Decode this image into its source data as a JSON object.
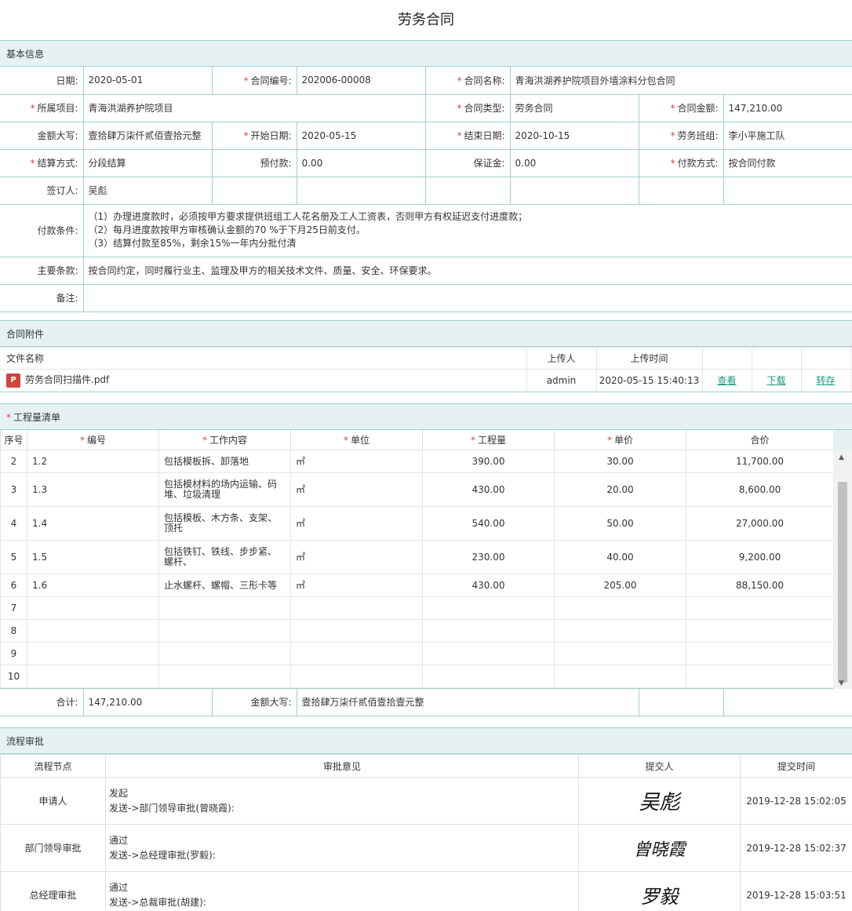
{
  "page_title": "劳务合同",
  "basic": {
    "section_title": "基本信息",
    "date_label": "日期:",
    "date": "2020-05-01",
    "contract_no_label": "合同编号:",
    "contract_no": "202006-00008",
    "contract_name_label": "合同名称:",
    "contract_name": "青海洪湖养护院项目外墙涂料分包合同",
    "project_label": "所属项目:",
    "project": "青海洪湖养护院项目",
    "contract_type_label": "合同类型:",
    "contract_type": "劳务合同",
    "amount_label": "合同金额:",
    "amount": "147,210.00",
    "amount_cn_label": "金额大写:",
    "amount_cn": "壹拾肆万柒仟贰佰壹拾元整",
    "start_label": "开始日期:",
    "start": "2020-05-15",
    "end_label": "结束日期:",
    "end": "2020-10-15",
    "team_label": "劳务班组:",
    "team": "李小平施工队",
    "settle_label": "结算方式:",
    "settle": "分段结算",
    "prepay_label": "预付款:",
    "prepay": "0.00",
    "deposit_label": "保证金:",
    "deposit": "0.00",
    "paymethod_label": "付款方式:",
    "paymethod": "按合同付款",
    "signer_label": "签订人:",
    "signer": "吴彪",
    "payterms_label": "付款条件:",
    "payterms": [
      "（1）办理进度款时，必须按甲方要求提供班组工人花名册及工人工资表，否则甲方有权延迟支付进度款；",
      "（2）每月进度款按甲方审核确认金额的70 %于下月25日前支付。",
      "（3）结算付款至85%，剩余15%一年内分批付清"
    ],
    "terms_label": "主要条款:",
    "terms": "按合同约定，同时履行业主、监理及甲方的相关技术文件、质量、安全、环保要求。",
    "remark_label": "备注:"
  },
  "attachments": {
    "section_title": "合同附件",
    "headers": [
      "文件名称",
      "上传人",
      "上传时间"
    ],
    "files": [
      {
        "name": "劳务合同扫描件.pdf",
        "uploader": "admin",
        "time": "2020-05-15 15:40:13",
        "view": "查看",
        "download": "下载",
        "transfer": "转存"
      }
    ]
  },
  "quantities": {
    "section_title": "工程量清单",
    "headers": [
      "序号",
      "编号",
      "工作内容",
      "单位",
      "工程量",
      "单价",
      "合价"
    ],
    "rows": [
      {
        "seq": "2",
        "code": "1.2",
        "content": "包括模板拆、卸落地",
        "unit": "㎡",
        "qty": "390.00",
        "price": "30.00",
        "total": "11,700.00"
      },
      {
        "seq": "3",
        "code": "1.3",
        "content": "包括模材料的场内运输、码堆、垃圾清理",
        "unit": "㎡",
        "qty": "430.00",
        "price": "20.00",
        "total": "8,600.00"
      },
      {
        "seq": "4",
        "code": "1.4",
        "content": "包括模板、木方条、支架、顶托",
        "unit": "㎡",
        "qty": "540.00",
        "price": "50.00",
        "total": "27,000.00"
      },
      {
        "seq": "5",
        "code": "1.5",
        "content": "包括铁钉、铁线、步步紧、螺杆、",
        "unit": "㎡",
        "qty": "230.00",
        "price": "40.00",
        "total": "9,200.00"
      },
      {
        "seq": "6",
        "code": "1.6",
        "content": "止水螺杆、螺帽、三形卡等",
        "unit": "㎡",
        "qty": "430.00",
        "price": "205.00",
        "total": "88,150.00"
      },
      {
        "seq": "7",
        "code": "",
        "content": "",
        "unit": "",
        "qty": "",
        "price": "",
        "total": ""
      },
      {
        "seq": "8",
        "code": "",
        "content": "",
        "unit": "",
        "qty": "",
        "price": "",
        "total": ""
      },
      {
        "seq": "9",
        "code": "",
        "content": "",
        "unit": "",
        "qty": "",
        "price": "",
        "total": ""
      },
      {
        "seq": "10",
        "code": "",
        "content": "",
        "unit": "",
        "qty": "",
        "price": "",
        "total": ""
      }
    ],
    "sum_label": "合计:",
    "sum": "147,210.00",
    "sum_cn_label": "金额大写:",
    "sum_cn": "壹拾肆万柒仟贰佰壹拾壹元整"
  },
  "flow": {
    "section_title": "流程审批",
    "headers": [
      "流程节点",
      "审批意见",
      "提交人",
      "提交时间"
    ],
    "steps": [
      {
        "node": "申请人",
        "opinion": "发起",
        "action": "发送->部门领导审批(曾晓霞):",
        "signature": "吴彪",
        "time": "2019-12-28 15:02:05"
      },
      {
        "node": "部门领导审批",
        "opinion": "通过",
        "action": "发送->总经理审批(罗毅):",
        "signature": "曾晓霞",
        "time": "2019-12-28 15:02:37"
      },
      {
        "node": "总经理审批",
        "opinion": "通过",
        "action": "发送->总裁审批(胡建):",
        "signature": "罗毅",
        "time": "2019-12-28 15:03:51"
      }
    ]
  }
}
